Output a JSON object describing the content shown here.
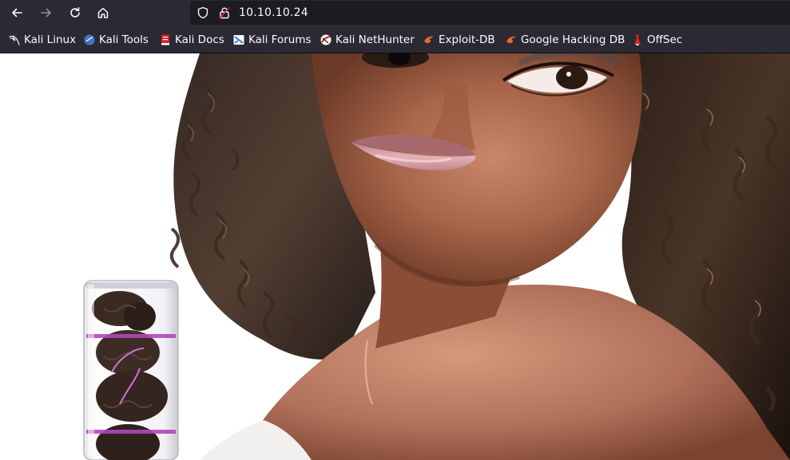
{
  "browser": {
    "url": "10.10.10.24",
    "bookmarks": [
      {
        "label": "Kali Linux",
        "icon": "kali-dragon-icon",
        "color": "#e8e8ea"
      },
      {
        "label": "Kali Tools",
        "icon": "kali-tools-icon",
        "color": "#3a78d8"
      },
      {
        "label": "Kali Docs",
        "icon": "kali-docs-icon",
        "color": "#d9232e"
      },
      {
        "label": "Kali Forums",
        "icon": "kali-forums-icon",
        "color": "#3a78d8"
      },
      {
        "label": "Kali NetHunter",
        "icon": "kali-nethunter-icon",
        "color": "#d9232e"
      },
      {
        "label": "Exploit-DB",
        "icon": "exploit-db-icon",
        "color": "#e0662a"
      },
      {
        "label": "Google Hacking DB",
        "icon": "ghdb-icon",
        "color": "#e0662a"
      },
      {
        "label": "OffSec",
        "icon": "offsec-icon",
        "color": "#d9232e"
      }
    ]
  },
  "page": {
    "image_alt": ""
  }
}
